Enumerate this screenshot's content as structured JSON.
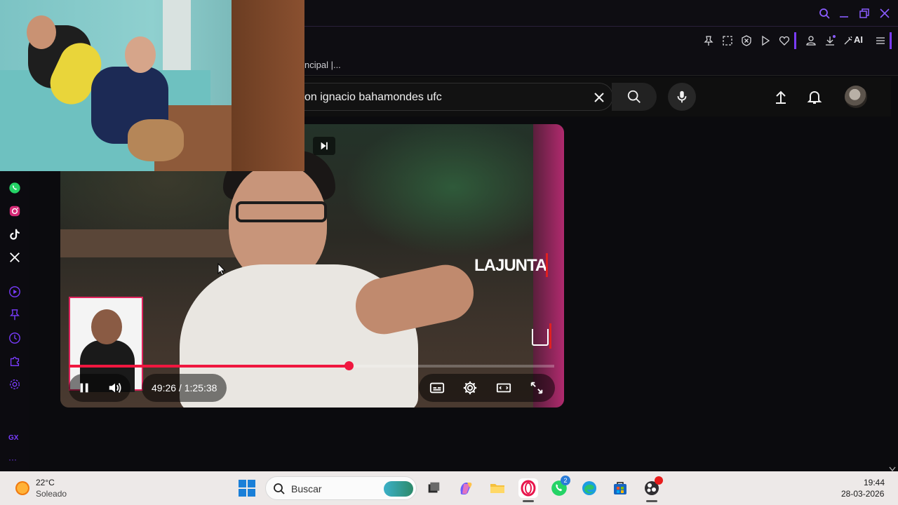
{
  "browser": {
    "tab_title": "ncipal |...",
    "ai_label": "AI"
  },
  "youtube": {
    "search_query": "on ignacio bahamondes ufc"
  },
  "video": {
    "current_time": "49:26",
    "duration": "1:25:38",
    "time_display": "49:26 / 1:25:38",
    "progress_fraction": 0.577,
    "watermark": "LAJUNTA",
    "watermark_small": "J"
  },
  "taskbar": {
    "temperature": "22°C",
    "condition": "Soleado",
    "search_placeholder": "Buscar",
    "whatsapp_badge": "2",
    "clock_time": "19:44",
    "clock_date": "28-03-2026"
  },
  "sidebar": {
    "gx_label": "GX",
    "more_label": "···"
  },
  "colors": {
    "accent_purple": "#7a3cff",
    "progress_red": "#f0173f",
    "youtube_bg": "#0f0f0f"
  }
}
